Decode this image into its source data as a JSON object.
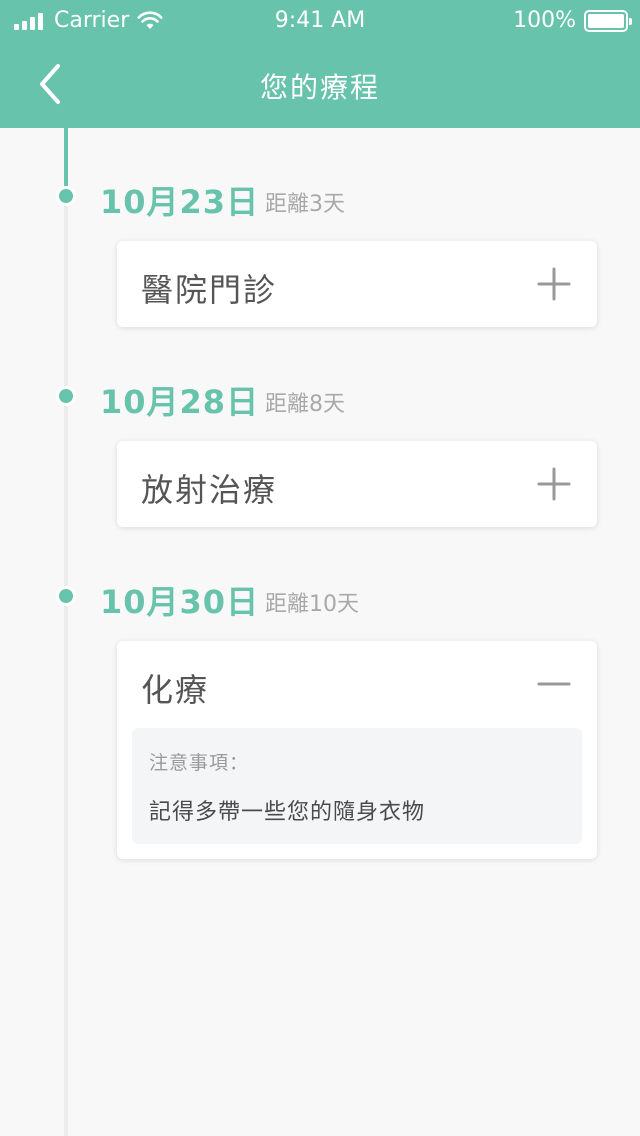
{
  "status_bar": {
    "carrier": "Carrier",
    "time": "9:41 AM",
    "battery": "100%"
  },
  "nav": {
    "title": "您的療程",
    "back_icon": "chevron-left-icon"
  },
  "colors": {
    "accent": "#67c3ab",
    "background": "#f8f8f8",
    "card": "#ffffff",
    "muted_text": "#a9a9a9"
  },
  "timeline": [
    {
      "date": "10月23日",
      "distance": "距離3天",
      "title": "醫院門診",
      "expanded": false,
      "toggle_icon": "plus-icon"
    },
    {
      "date": "10月28日",
      "distance": "距離8天",
      "title": "放射治療",
      "expanded": false,
      "toggle_icon": "plus-icon"
    },
    {
      "date": "10月30日",
      "distance": "距離10天",
      "title": "化療",
      "expanded": true,
      "toggle_icon": "minus-icon",
      "note_label": "注意事項：",
      "note_text": "記得多帶一些您的隨身衣物"
    }
  ]
}
